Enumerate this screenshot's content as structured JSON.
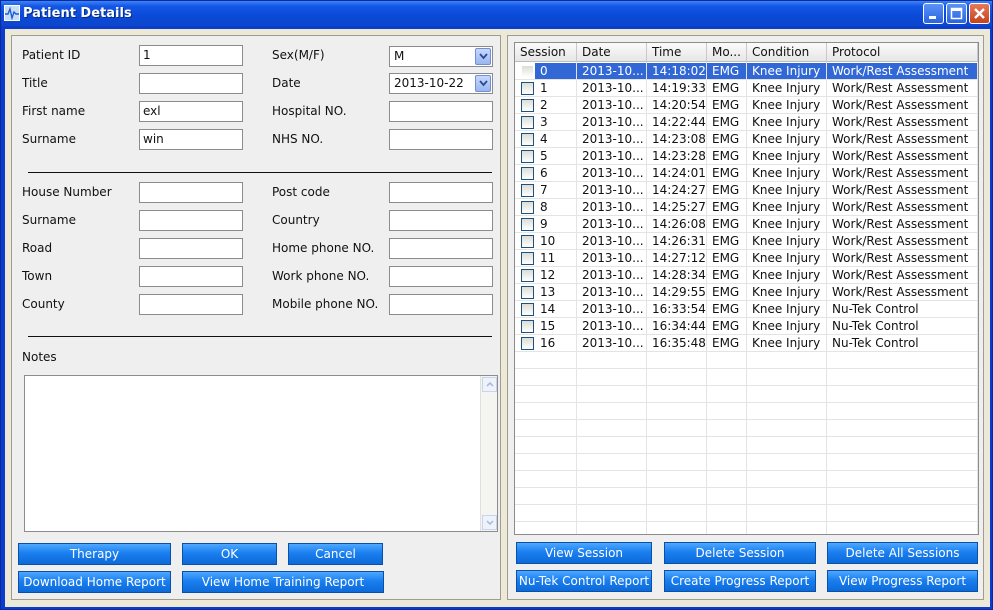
{
  "window": {
    "title": "Patient Details"
  },
  "form": {
    "patient_id": {
      "label": "Patient ID",
      "value": "1"
    },
    "title": {
      "label": "Title",
      "value": ""
    },
    "first_name": {
      "label": "First name",
      "value": "exl"
    },
    "surname": {
      "label": "Surname",
      "value": "win"
    },
    "sex": {
      "label": "Sex(M/F)",
      "value": "M"
    },
    "date": {
      "label": "Date",
      "value": "2013-10-22"
    },
    "hospital_no": {
      "label": "Hospital NO.",
      "value": ""
    },
    "nhs_no": {
      "label": "NHS NO.",
      "value": ""
    },
    "house_number": {
      "label": "House Number",
      "value": ""
    },
    "address_surname": {
      "label": "Surname",
      "value": ""
    },
    "road": {
      "label": "Road",
      "value": ""
    },
    "town": {
      "label": "Town",
      "value": ""
    },
    "county": {
      "label": "County",
      "value": ""
    },
    "post_code": {
      "label": "Post code",
      "value": ""
    },
    "country": {
      "label": "Country",
      "value": ""
    },
    "home_phone": {
      "label": "Home phone NO.",
      "value": ""
    },
    "work_phone": {
      "label": "Work phone NO.",
      "value": ""
    },
    "mobile_phone": {
      "label": "Mobile phone NO.",
      "value": ""
    },
    "notes": {
      "label": "Notes",
      "value": ""
    }
  },
  "left_buttons": {
    "therapy": "Therapy",
    "ok": "OK",
    "cancel": "Cancel",
    "download_home_report": "Download Home Report",
    "view_home_training_report": "View Home Training Report"
  },
  "sessions": {
    "columns": [
      "Session",
      "Date",
      "Time",
      "Mo...",
      "Condition",
      "Protocol"
    ],
    "selected_index": 0,
    "rows": [
      {
        "session": "0",
        "date": "2013-10...",
        "time": "14:18:02",
        "mode": "EMG",
        "condition": "Knee Injury",
        "protocol": "Work/Rest Assessment"
      },
      {
        "session": "1",
        "date": "2013-10...",
        "time": "14:19:33",
        "mode": "EMG",
        "condition": "Knee Injury",
        "protocol": "Work/Rest Assessment"
      },
      {
        "session": "2",
        "date": "2013-10...",
        "time": "14:20:54",
        "mode": "EMG",
        "condition": "Knee Injury",
        "protocol": "Work/Rest Assessment"
      },
      {
        "session": "3",
        "date": "2013-10...",
        "time": "14:22:44",
        "mode": "EMG",
        "condition": "Knee Injury",
        "protocol": "Work/Rest Assessment"
      },
      {
        "session": "4",
        "date": "2013-10...",
        "time": "14:23:08",
        "mode": "EMG",
        "condition": "Knee Injury",
        "protocol": "Work/Rest Assessment"
      },
      {
        "session": "5",
        "date": "2013-10...",
        "time": "14:23:28",
        "mode": "EMG",
        "condition": "Knee Injury",
        "protocol": "Work/Rest Assessment"
      },
      {
        "session": "6",
        "date": "2013-10...",
        "time": "14:24:01",
        "mode": "EMG",
        "condition": "Knee Injury",
        "protocol": "Work/Rest Assessment"
      },
      {
        "session": "7",
        "date": "2013-10...",
        "time": "14:24:27",
        "mode": "EMG",
        "condition": "Knee Injury",
        "protocol": "Work/Rest Assessment"
      },
      {
        "session": "8",
        "date": "2013-10...",
        "time": "14:25:27",
        "mode": "EMG",
        "condition": "Knee Injury",
        "protocol": "Work/Rest Assessment"
      },
      {
        "session": "9",
        "date": "2013-10...",
        "time": "14:26:08",
        "mode": "EMG",
        "condition": "Knee Injury",
        "protocol": "Work/Rest Assessment"
      },
      {
        "session": "10",
        "date": "2013-10...",
        "time": "14:26:31",
        "mode": "EMG",
        "condition": "Knee Injury",
        "protocol": "Work/Rest Assessment"
      },
      {
        "session": "11",
        "date": "2013-10...",
        "time": "14:27:12",
        "mode": "EMG",
        "condition": "Knee Injury",
        "protocol": "Work/Rest Assessment"
      },
      {
        "session": "12",
        "date": "2013-10...",
        "time": "14:28:34",
        "mode": "EMG",
        "condition": "Knee Injury",
        "protocol": "Work/Rest Assessment"
      },
      {
        "session": "13",
        "date": "2013-10...",
        "time": "14:29:55",
        "mode": "EMG",
        "condition": "Knee Injury",
        "protocol": "Work/Rest Assessment"
      },
      {
        "session": "14",
        "date": "2013-10...",
        "time": "16:33:54",
        "mode": "EMG",
        "condition": "Knee Injury",
        "protocol": "Nu-Tek Control"
      },
      {
        "session": "15",
        "date": "2013-10...",
        "time": "16:34:44",
        "mode": "EMG",
        "condition": "Knee Injury",
        "protocol": "Nu-Tek Control"
      },
      {
        "session": "16",
        "date": "2013-10...",
        "time": "16:35:48",
        "mode": "EMG",
        "condition": "Knee Injury",
        "protocol": "Nu-Tek Control"
      }
    ]
  },
  "right_buttons": {
    "view_session": "View Session",
    "delete_session": "Delete Session",
    "delete_all_sessions": "Delete All Sessions",
    "nutek_control_report": "Nu-Tek Control Report",
    "create_progress_report": "Create Progress Report",
    "view_progress_report": "View Progress Report"
  },
  "colors": {
    "title_bar": "#0c46cc",
    "button_blue": "#1a7ff0",
    "selection": "#3168d5"
  },
  "icons": {
    "app": "waveform-icon",
    "minimize": "minimize-icon",
    "maximize": "maximize-icon",
    "close": "close-icon",
    "dropdown": "chevron-down-icon"
  }
}
